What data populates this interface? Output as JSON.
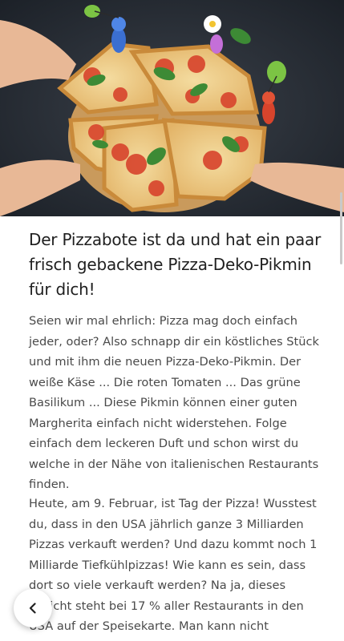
{
  "hero": {
    "image_description": "pizza-with-pikmin"
  },
  "article": {
    "headline": "Der Pizzabote ist da und hat ein paar frisch gebackene Pizza-Deko-Pikmin für dich!",
    "paragraphs": [
      "Seien wir mal ehrlich: Pizza mag doch einfach jeder, oder? Also schnapp dir ein köstliches Stück und mit ihm die neuen Pizza-Deko-Pikmin. Der weiße Käse ... Die roten Tomaten ... Das grüne Basilikum ... Diese Pikmin können einer guten Margherita einfach nicht widerstehen. Folge einfach dem leckeren Duft und schon wirst du welche in der Nähe von italienischen Restaurants finden.",
      "Heute, am 9. Februar, ist Tag der Pizza! Wusstest du, dass in den USA jährlich ganze 3 Milliarden Pizzas verkauft werden? Und dazu kommt noch 1 Milliarde Tiefkühlpizzas! Wie kann es sein, dass dort so viele verkauft werden? Na ja, dieses Gericht steht bei 17 % aller Restaurants in den USA auf der Speisekarte. Man kann nicht bestreiten, dass die"
    ]
  },
  "navigation": {
    "back_icon": "chevron-left-icon"
  },
  "colors": {
    "background": "#ffffff",
    "hero_background": "#242a32",
    "text": "#4a4a4a",
    "headline": "#1f1f1f"
  }
}
